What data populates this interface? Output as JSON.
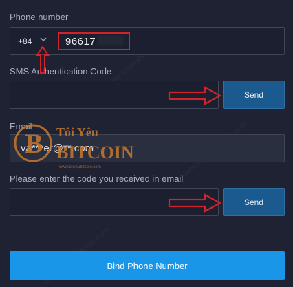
{
  "phone": {
    "label": "Phone number",
    "country_code": "+84",
    "number_visible": "96617"
  },
  "sms": {
    "label": "SMS Authentication Code",
    "send_label": "Send"
  },
  "email": {
    "label": "Email",
    "value": "va***er@**.com",
    "code_label": "Please enter the code you received in email",
    "send_label": "Send"
  },
  "submit": {
    "label": "Bind Phone Number"
  },
  "watermark": {
    "brand_line1": "Tôi Yêu",
    "brand_line2": "BITCOIN",
    "url": "www.toiyeubitcoin.com"
  },
  "colors": {
    "background": "#1e2233",
    "send_button": "#1a5a8e",
    "primary_button": "#1a96e8",
    "annotation_red": "#d3232a",
    "watermark_orange": "#c8772b"
  }
}
